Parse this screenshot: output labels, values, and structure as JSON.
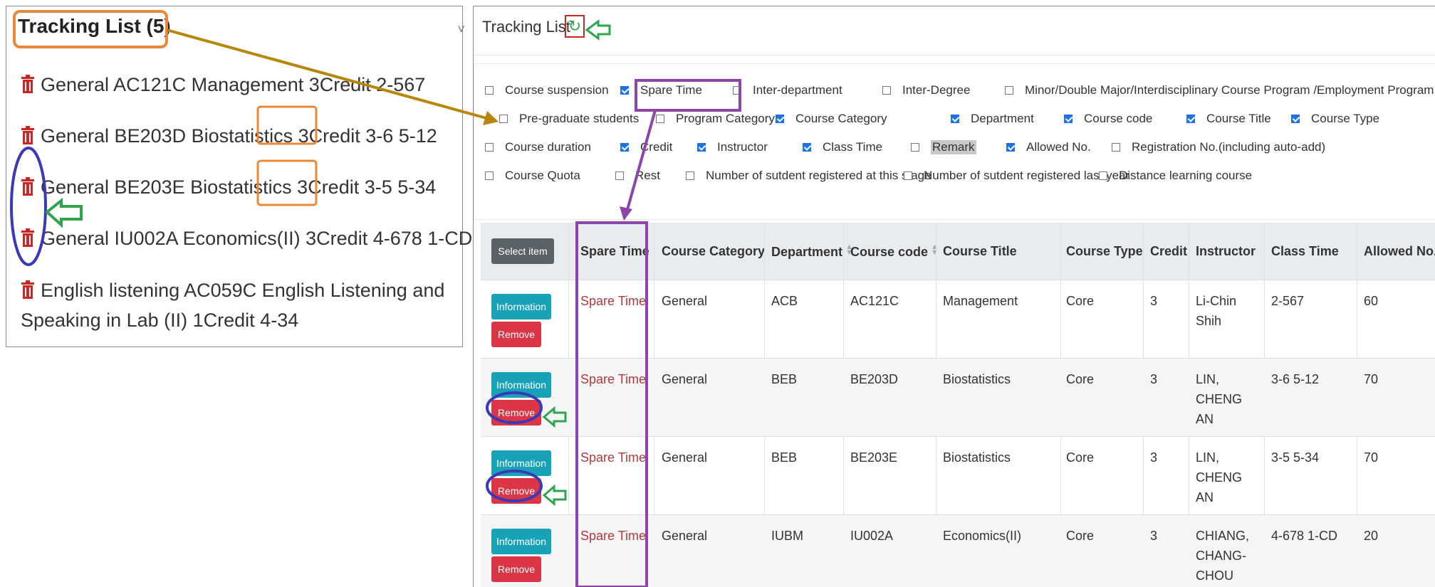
{
  "left": {
    "title": "Tracking List (5)",
    "collapse": "˅",
    "items": [
      "General AC121C Management 3Credit 2-567",
      "General BE203D Biostatistics 3Credit 3-6 5-12",
      "General BE203E Biostatistics 3Credit 3-5 5-34",
      "General IU002A Economics(II) 3Credit 4-678 1-CD",
      "English listening AC059C English Listening and Speaking in Lab (II) 1Credit 4-34"
    ]
  },
  "right": {
    "title": "Tracking List",
    "filters": [
      {
        "label": "Course suspension",
        "checked": false
      },
      {
        "label": "Spare Time",
        "checked": true
      },
      {
        "label": "Inter-department",
        "checked": false
      },
      {
        "label": "Inter-Degree",
        "checked": false
      },
      {
        "label": "Minor/Double Major/Interdisciplinary Course Program /Employment Program",
        "checked": false
      },
      {
        "label": "Pre-graduate students",
        "checked": false
      },
      {
        "label": "Program Category",
        "checked": false
      },
      {
        "label": "Course Category",
        "checked": true
      },
      {
        "label": "Department",
        "checked": true
      },
      {
        "label": "Course code",
        "checked": true
      },
      {
        "label": "Course Title",
        "checked": true
      },
      {
        "label": "Course Type",
        "checked": true
      },
      {
        "label": "Course duration",
        "checked": false
      },
      {
        "label": "Credit",
        "checked": true
      },
      {
        "label": "Instructor",
        "checked": true
      },
      {
        "label": "Class Time",
        "checked": true
      },
      {
        "label": "Remark",
        "checked": false
      },
      {
        "label": "Allowed No.",
        "checked": true
      },
      {
        "label": "Registration No.(including auto-add)",
        "checked": false
      },
      {
        "label": "Course Quota",
        "checked": false
      },
      {
        "label": "Rest",
        "checked": false
      },
      {
        "label": "Number of sutdent registered at this stage",
        "checked": false
      },
      {
        "label": "Number of sutdent registered last year",
        "checked": false
      },
      {
        "label": "Distance learning course",
        "checked": false
      }
    ],
    "select_item": "Select item",
    "columns": [
      "Spare Time",
      "Course Category",
      "Department",
      "Course code",
      "Course Title",
      "Course Type",
      "Credit",
      "Instructor",
      "Class Time",
      "Allowed No."
    ],
    "info_label": "Information",
    "remove_label": "Remove",
    "rows": [
      {
        "spare": "Spare Time",
        "category": "General",
        "dept": "ACB",
        "code": "AC121C",
        "title": "Management",
        "type": "Core",
        "credit": "3",
        "instructor": "Li-Chin Shih",
        "time": "2-567",
        "allowed": "60"
      },
      {
        "spare": "Spare Time",
        "category": "General",
        "dept": "BEB",
        "code": "BE203D",
        "title": "Biostatistics",
        "type": "Core",
        "credit": "3",
        "instructor": "LIN, CHENG AN",
        "time": "3-6 5-12",
        "allowed": "70"
      },
      {
        "spare": "Spare Time",
        "category": "General",
        "dept": "BEB",
        "code": "BE203E",
        "title": "Biostatistics",
        "type": "Core",
        "credit": "3",
        "instructor": "LIN, CHENG AN",
        "time": "3-5 5-34",
        "allowed": "70"
      },
      {
        "spare": "Spare Time",
        "category": "General",
        "dept": "IUBM",
        "code": "IU002A",
        "title": "Economics(II)",
        "type": "Core",
        "credit": "3",
        "instructor": "CHIANG, CHANG-CHOU",
        "time": "4-678 1-CD",
        "allowed": "20"
      }
    ]
  },
  "colors": {
    "info": "#17a2b8",
    "remove": "#dc3545",
    "accent_orange": "#e8883a",
    "accent_purple": "#8e44ad",
    "accent_blue": "#3a3ab8",
    "accent_green": "#2ea44f",
    "arrow_gold": "#b8860b"
  }
}
